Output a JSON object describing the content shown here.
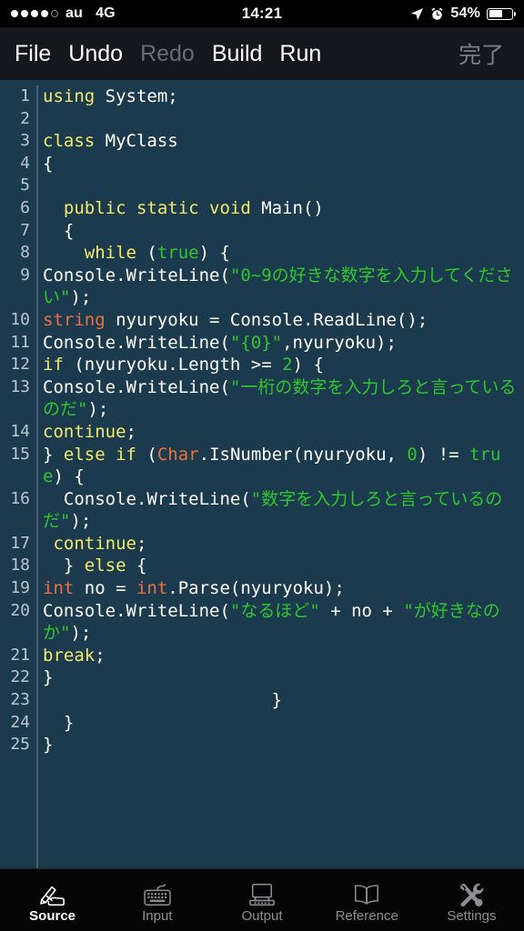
{
  "status_bar": {
    "signal_dots_filled": 4,
    "signal_dots_total": 5,
    "carrier": "au",
    "network": "4G",
    "time": "14:21",
    "battery_percent": "54%",
    "battery_level": 54,
    "icons": [
      "location-arrow-icon",
      "alarm-clock-icon",
      "battery-icon"
    ]
  },
  "toolbar": {
    "items": [
      {
        "label": "File",
        "disabled": false
      },
      {
        "label": "Undo",
        "disabled": false
      },
      {
        "label": "Redo",
        "disabled": true
      },
      {
        "label": "Build",
        "disabled": false
      },
      {
        "label": "Run",
        "disabled": false
      }
    ],
    "done_label": "完了"
  },
  "editor": {
    "language": "csharp",
    "total_lines": 25,
    "colors": {
      "background": "#1c3a4d",
      "keyword": "#f2e96a",
      "type": "#e8733f",
      "string": "#2fc62f",
      "number": "#2fc62f",
      "plain": "#ffffff",
      "gutter_text": "#b9c6cf",
      "gutter_rule": "#46606f"
    },
    "lines": [
      {
        "num": "1",
        "wraps": 1,
        "tokens": [
          {
            "t": "using",
            "c": "k"
          },
          {
            "t": " System;",
            "c": "p"
          }
        ]
      },
      {
        "num": "2",
        "wraps": 1,
        "tokens": [
          {
            "t": "",
            "c": "p"
          }
        ]
      },
      {
        "num": "3",
        "wraps": 1,
        "tokens": [
          {
            "t": "class",
            "c": "k"
          },
          {
            "t": " MyClass",
            "c": "p"
          }
        ]
      },
      {
        "num": "4",
        "wraps": 1,
        "tokens": [
          {
            "t": "{",
            "c": "p"
          }
        ]
      },
      {
        "num": "5",
        "wraps": 1,
        "tokens": [
          {
            "t": "",
            "c": "p"
          }
        ]
      },
      {
        "num": "6",
        "wraps": 1,
        "tokens": [
          {
            "t": "  ",
            "c": "p"
          },
          {
            "t": "public static void",
            "c": "k"
          },
          {
            "t": " Main()",
            "c": "p"
          }
        ]
      },
      {
        "num": "7",
        "wraps": 1,
        "tokens": [
          {
            "t": "  {",
            "c": "p"
          }
        ]
      },
      {
        "num": "8",
        "wraps": 1,
        "tokens": [
          {
            "t": "    ",
            "c": "p"
          },
          {
            "t": "while",
            "c": "k"
          },
          {
            "t": " (",
            "c": "p"
          },
          {
            "t": "true",
            "c": "n"
          },
          {
            "t": ") {",
            "c": "p"
          }
        ]
      },
      {
        "num": "9",
        "wraps": 2,
        "tokens": [
          {
            "t": "Console.WriteLine(",
            "c": "p"
          },
          {
            "t": "\"0~9の好きな数字を入力してください\"",
            "c": "s"
          },
          {
            "t": ");",
            "c": "p"
          }
        ]
      },
      {
        "num": "10",
        "wraps": 1,
        "tokens": [
          {
            "t": "string",
            "c": "t"
          },
          {
            "t": " nyuryoku = Console.ReadLine();",
            "c": "p"
          }
        ]
      },
      {
        "num": "11",
        "wraps": 1,
        "tokens": [
          {
            "t": "Console.WriteLine(",
            "c": "p"
          },
          {
            "t": "\"{0}\"",
            "c": "s"
          },
          {
            "t": ",nyuryoku);",
            "c": "p"
          }
        ]
      },
      {
        "num": "12",
        "wraps": 1,
        "tokens": [
          {
            "t": "if",
            "c": "k"
          },
          {
            "t": " (nyuryoku.Length >= ",
            "c": "p"
          },
          {
            "t": "2",
            "c": "n"
          },
          {
            "t": ") {",
            "c": "p"
          }
        ]
      },
      {
        "num": "13",
        "wraps": 2,
        "tokens": [
          {
            "t": "Console.WriteLine(",
            "c": "p"
          },
          {
            "t": "\"一桁の数字を入力しろと言っているのだ\"",
            "c": "s"
          },
          {
            "t": ");",
            "c": "p"
          }
        ]
      },
      {
        "num": "14",
        "wraps": 1,
        "tokens": [
          {
            "t": "continue",
            "c": "k"
          },
          {
            "t": ";",
            "c": "p"
          }
        ]
      },
      {
        "num": "15",
        "wraps": 2,
        "tokens": [
          {
            "t": "} ",
            "c": "p"
          },
          {
            "t": "else if",
            "c": "k"
          },
          {
            "t": " (",
            "c": "p"
          },
          {
            "t": "Char",
            "c": "t"
          },
          {
            "t": ".IsNumber(nyuryoku, ",
            "c": "p"
          },
          {
            "t": "0",
            "c": "n"
          },
          {
            "t": ") != ",
            "c": "p"
          },
          {
            "t": "true",
            "c": "n"
          },
          {
            "t": ") {",
            "c": "p"
          }
        ]
      },
      {
        "num": "16",
        "wraps": 2,
        "tokens": [
          {
            "t": "  Console.WriteLine(",
            "c": "p"
          },
          {
            "t": "\"数字を入力しろと言っているのだ\"",
            "c": "s"
          },
          {
            "t": ");",
            "c": "p"
          }
        ]
      },
      {
        "num": "17",
        "wraps": 1,
        "tokens": [
          {
            "t": " ",
            "c": "p"
          },
          {
            "t": "continue",
            "c": "k"
          },
          {
            "t": ";",
            "c": "p"
          }
        ]
      },
      {
        "num": "18",
        "wraps": 1,
        "tokens": [
          {
            "t": "  } ",
            "c": "p"
          },
          {
            "t": "else",
            "c": "k"
          },
          {
            "t": " {",
            "c": "p"
          }
        ]
      },
      {
        "num": "19",
        "wraps": 1,
        "tokens": [
          {
            "t": "int",
            "c": "t"
          },
          {
            "t": " no = ",
            "c": "p"
          },
          {
            "t": "int",
            "c": "t"
          },
          {
            "t": ".Parse(nyuryoku);",
            "c": "p"
          }
        ]
      },
      {
        "num": "20",
        "wraps": 2,
        "tokens": [
          {
            "t": "Console.WriteLine(",
            "c": "p"
          },
          {
            "t": "\"なるほど\"",
            "c": "s"
          },
          {
            "t": " + no + ",
            "c": "p"
          },
          {
            "t": "\"が好きなのか\"",
            "c": "s"
          },
          {
            "t": ");",
            "c": "p"
          }
        ]
      },
      {
        "num": "21",
        "wraps": 1,
        "tokens": [
          {
            "t": "break",
            "c": "k"
          },
          {
            "t": ";",
            "c": "p"
          }
        ]
      },
      {
        "num": "22",
        "wraps": 1,
        "tokens": [
          {
            "t": "}",
            "c": "p"
          }
        ]
      },
      {
        "num": "23",
        "wraps": 1,
        "tokens": [
          {
            "t": "                      }",
            "c": "p"
          }
        ]
      },
      {
        "num": "24",
        "wraps": 1,
        "tokens": [
          {
            "t": "  }",
            "c": "p"
          }
        ]
      },
      {
        "num": "25",
        "wraps": 1,
        "tokens": [
          {
            "t": "}",
            "c": "p"
          }
        ]
      }
    ]
  },
  "tabbar": {
    "tabs": [
      {
        "label": "Source",
        "icon": "hand-writing-pen-icon",
        "active": true
      },
      {
        "label": "Input",
        "icon": "keyboard-icon",
        "active": false
      },
      {
        "label": "Output",
        "icon": "computer-monitor-icon",
        "active": false
      },
      {
        "label": "Reference",
        "icon": "open-book-icon",
        "active": false
      },
      {
        "label": "Settings",
        "icon": "tools-wrench-icon",
        "active": false
      }
    ]
  }
}
